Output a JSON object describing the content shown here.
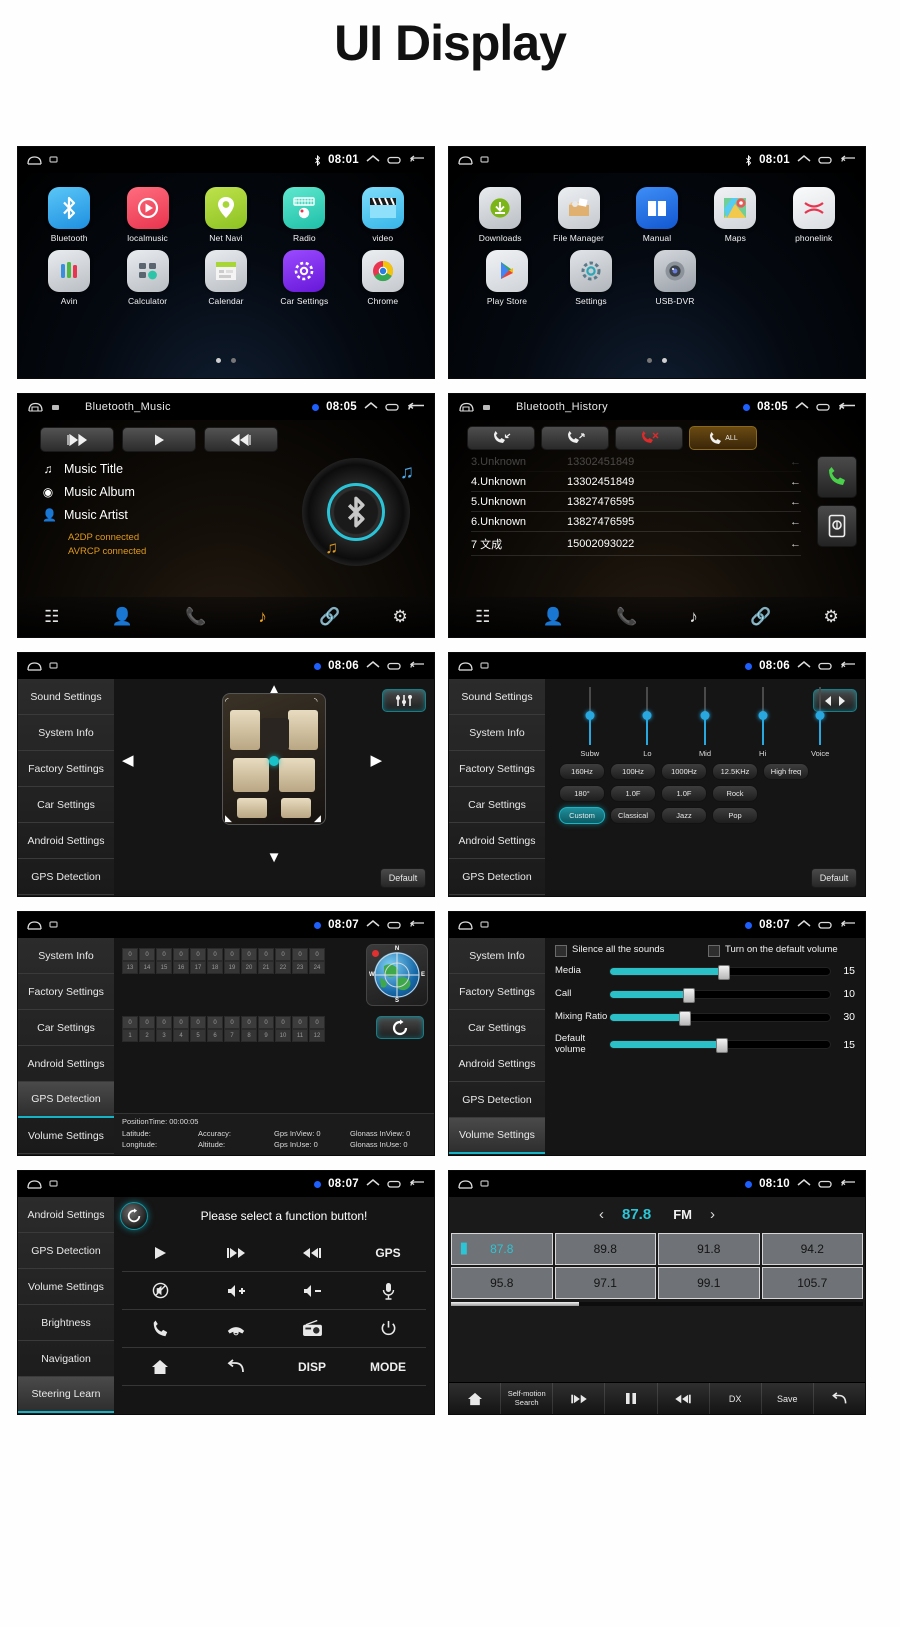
{
  "title": "UI Display",
  "panels": {
    "home1": {
      "status": {
        "time": "08:01",
        "bt": "bluetooth-icon"
      },
      "apps_row1": [
        {
          "label": "Bluetooth",
          "icon": "bluetooth-icon",
          "color": "#2aa8ef"
        },
        {
          "label": "localmusic",
          "icon": "music-play-icon",
          "color": "#f04b5e"
        },
        {
          "label": "Net Navi",
          "icon": "map-pin-icon",
          "color": "#a8d636"
        },
        {
          "label": "Radio",
          "icon": "radio-icon",
          "color": "#37d6c0"
        },
        {
          "label": "video",
          "icon": "clapperboard-icon",
          "color": "#5ecdf2"
        }
      ],
      "apps_row2": [
        {
          "label": "Avin",
          "icon": "avin-icon",
          "color": "#c9cdd2"
        },
        {
          "label": "Calculator",
          "icon": "calculator-icon",
          "color": "#c9cdd2"
        },
        {
          "label": "Calendar",
          "icon": "calendar-icon",
          "color": "#c9cdd2"
        },
        {
          "label": "Car Settings",
          "icon": "gear-purple-icon",
          "color": "#7b2ff7"
        },
        {
          "label": "Chrome",
          "icon": "chrome-icon",
          "color": "#d8dade"
        }
      ],
      "page_dots": 2,
      "active_dot": 0
    },
    "home2": {
      "status": {
        "time": "08:01"
      },
      "apps_row1": [
        {
          "label": "Downloads",
          "icon": "download-icon",
          "color": "#d2d5d9"
        },
        {
          "label": "File Manager",
          "icon": "file-manager-icon",
          "color": "#d8d2c6"
        },
        {
          "label": "Manual",
          "icon": "book-icon",
          "color": "#2a6cf0"
        },
        {
          "label": "Maps",
          "icon": "maps-icon",
          "color": "#e8e8e8"
        },
        {
          "label": "phonelink",
          "icon": "phonelink-icon",
          "color": "#f0f0f0"
        }
      ],
      "apps_row2": [
        {
          "label": "Play Store",
          "icon": "play-store-icon",
          "color": "#e2e4e7"
        },
        {
          "label": "Settings",
          "icon": "gear-icon",
          "color": "#d2d5d9"
        },
        {
          "label": "USB-DVR",
          "icon": "camera-icon",
          "color": "#c8ccd1"
        }
      ],
      "page_dots": 2,
      "active_dot": 1
    },
    "bt_music": {
      "status": {
        "title": "Bluetooth_Music",
        "time": "08:05"
      },
      "controls": [
        "prev-track",
        "play",
        "next-track"
      ],
      "track": {
        "title": "Music Title",
        "album": "Music Album",
        "artist": "Music Artist",
        "a2dp": "A2DP connected",
        "avrcp": "AVRCP connected"
      },
      "nav": [
        "dialpad-icon",
        "contacts-icon",
        "call-icon",
        "music-icon",
        "link-icon",
        "settings-icon"
      ],
      "nav_active": 3
    },
    "bt_history": {
      "status": {
        "title": "Bluetooth_History",
        "time": "08:05"
      },
      "tabs": [
        "incoming-calls",
        "outgoing-calls",
        "missed-calls",
        "all-calls"
      ],
      "tabs_active": 3,
      "all_label": "ALL",
      "rows": [
        {
          "name": "3.Unknown",
          "number": "13302451849",
          "dir": "←",
          "faded": true
        },
        {
          "name": "4.Unknown",
          "number": "13302451849",
          "dir": "←",
          "faded": false
        },
        {
          "name": "5.Unknown",
          "number": "13827476595",
          "dir": "←",
          "faded": false
        },
        {
          "name": "6.Unknown",
          "number": "13827476595",
          "dir": "←",
          "faded": false
        },
        {
          "name": "7 文成",
          "number": "15002093022",
          "dir": "←",
          "faded": false
        }
      ],
      "side": [
        "dial-call-icon",
        "sync-contacts-icon"
      ],
      "nav_active": 2
    },
    "car_settings": {
      "status": {
        "time": "08:06"
      },
      "menu": [
        "Sound Settings",
        "System Info",
        "Factory Settings",
        "Car Settings",
        "Android Settings",
        "GPS Detection"
      ],
      "menu_selected": -1,
      "eq_button": "balance-fader-icon",
      "default_label": "Default",
      "arrows": [
        "up",
        "down",
        "left",
        "right"
      ]
    },
    "equalizer": {
      "status": {
        "time": "08:06"
      },
      "menu": [
        "Sound Settings",
        "System Info",
        "Factory Settings",
        "Car Settings",
        "Android Settings",
        "GPS Detection"
      ],
      "balance_button": "balance-icon",
      "sliders": [
        {
          "label": "Subw",
          "value": 52
        },
        {
          "label": "Lo",
          "value": 52
        },
        {
          "label": "Mid",
          "value": 52
        },
        {
          "label": "Hi",
          "value": 52
        },
        {
          "label": "Voice",
          "value": 52
        }
      ],
      "freq_row": [
        "160Hz",
        "100Hz",
        "1000Hz",
        "12.5KHz",
        "High freq"
      ],
      "param_row": [
        "180°",
        "1.0F",
        "1.0F",
        "Rock"
      ],
      "preset_row": [
        "Custom",
        "Classical",
        "Jazz",
        "Pop"
      ],
      "preset_active": 0,
      "default_label": "Default"
    },
    "gps": {
      "status": {
        "time": "08:07"
      },
      "menu": [
        "System Info",
        "Factory Settings",
        "Car Settings",
        "Android Settings",
        "GPS Detection",
        "Volume Settings"
      ],
      "menu_selected": 4,
      "sat_values_top": [
        "0",
        "0",
        "0",
        "0",
        "0",
        "0",
        "0",
        "0",
        "0",
        "0",
        "0",
        "0"
      ],
      "sat_ids_top": [
        "13",
        "14",
        "15",
        "16",
        "17",
        "18",
        "19",
        "20",
        "21",
        "22",
        "23",
        "24"
      ],
      "sat_values_bottom": [
        "0",
        "0",
        "0",
        "0",
        "0",
        "0",
        "0",
        "0",
        "0",
        "0",
        "0",
        "0"
      ],
      "sat_ids_bottom": [
        "1",
        "2",
        "3",
        "4",
        "5",
        "6",
        "7",
        "8",
        "9",
        "10",
        "11",
        "12"
      ],
      "compass": {
        "n": "N",
        "s": "S",
        "e": "E",
        "w": "W"
      },
      "refresh_icon": "refresh-icon",
      "status_lines": {
        "position_time": "PositionTime: 00:00:05",
        "row1": [
          "Latitude:",
          "Accuracy:",
          "Gps InView: 0",
          "Glonass InView: 0"
        ],
        "row2": [
          "Longitude:",
          "Altitude:",
          "Gps InUse: 0",
          "Glonass InUse: 0"
        ]
      }
    },
    "volume": {
      "status": {
        "time": "08:07"
      },
      "menu": [
        "System Info",
        "Factory Settings",
        "Car Settings",
        "Android Settings",
        "GPS Detection",
        "Volume Settings"
      ],
      "menu_selected": 5,
      "checkboxes": [
        {
          "label": "Silence all the sounds",
          "checked": false
        },
        {
          "label": "Turn on the default volume",
          "checked": false
        }
      ],
      "sliders": [
        {
          "label": "Media",
          "value": "15",
          "pct": 52
        },
        {
          "label": "Call",
          "value": "10",
          "pct": 36
        },
        {
          "label": "Mixing Ratio",
          "value": "30",
          "pct": 34
        },
        {
          "label": "Default volume",
          "value": "15",
          "pct": 51
        }
      ]
    },
    "steering": {
      "status": {
        "time": "08:07"
      },
      "menu": [
        "Android Settings",
        "GPS Detection",
        "Volume Settings",
        "Brightness",
        "Navigation",
        "Steering Learn"
      ],
      "menu_selected": 5,
      "prompt": "Please select a function button!",
      "reset_icon": "reset-icon",
      "buttons": [
        [
          "play-icon",
          "prev-track-icon",
          "next-track-icon",
          "GPS"
        ],
        [
          "mute-icon",
          "volume-up-icon",
          "volume-down-icon",
          "mic-icon"
        ],
        [
          "call-icon",
          "hangup-icon",
          "radio-icon",
          "power-icon"
        ],
        [
          "home-icon",
          "back-icon",
          "DISP",
          "MODE"
        ]
      ]
    },
    "radio": {
      "status": {
        "time": "08:10"
      },
      "frequency": "87.8",
      "band": "FM",
      "prev_icon": "chevron-left-icon",
      "next_icon": "chevron-right-icon",
      "presets_row1": [
        "87.8",
        "89.8",
        "91.8",
        "94.2"
      ],
      "presets_row2": [
        "95.8",
        "97.1",
        "99.1",
        "105.7"
      ],
      "active_preset": "87.8",
      "progress_pct": 31,
      "toolbar": [
        {
          "label": "",
          "icon": "home-icon"
        },
        {
          "label": "Self-motion Search",
          "icon": ""
        },
        {
          "label": "",
          "icon": "prev-track-icon"
        },
        {
          "label": "",
          "icon": "pause-icon"
        },
        {
          "label": "",
          "icon": "next-track-icon"
        },
        {
          "label": "DX",
          "icon": ""
        },
        {
          "label": "Save",
          "icon": ""
        },
        {
          "label": "",
          "icon": "back-icon"
        }
      ]
    }
  }
}
